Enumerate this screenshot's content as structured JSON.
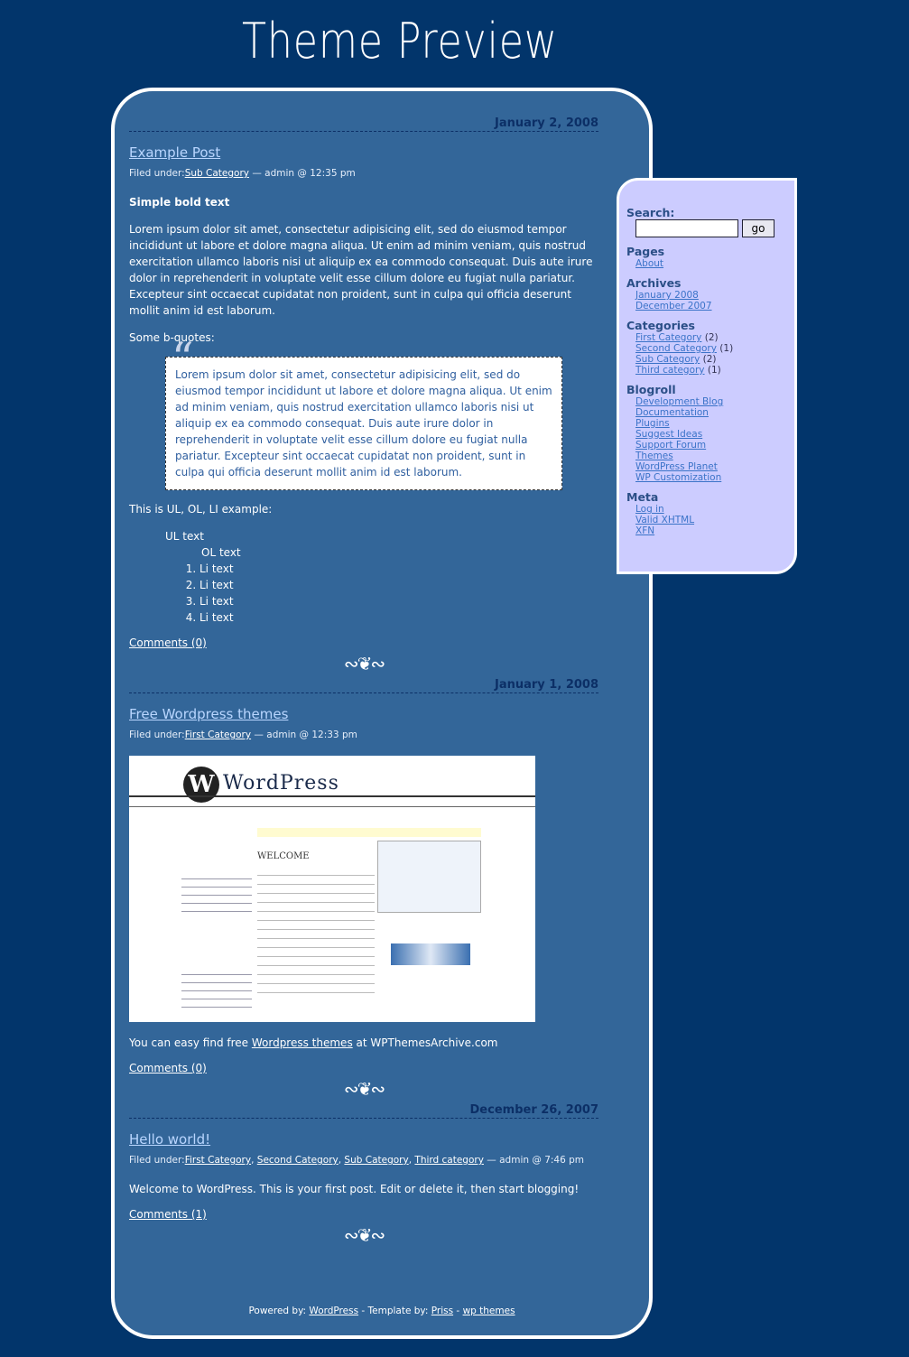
{
  "header": {
    "title": "Theme Preview"
  },
  "posts": [
    {
      "date": "January 2, 2008",
      "title": "Example Post",
      "filed_label": "Filed under:",
      "categories": [
        "Sub Category"
      ],
      "byline": " — admin @ 12:35 pm",
      "bold": "Simple bold text",
      "para": "Lorem ipsum dolor sit amet, consectetur adipisicing elit, sed do eiusmod tempor incididunt ut labore et dolore magna aliqua. Ut enim ad minim veniam, quis nostrud exercitation ullamco laboris nisi ut aliquip ex ea commodo consequat. Duis aute irure dolor in reprehenderit in voluptate velit esse cillum dolore eu fugiat nulla pariatur. Excepteur sint occaecat cupidatat non proident, sunt in culpa qui officia deserunt mollit anim id est laborum.",
      "bquote_intro": "Some b-quotes:",
      "bquote": "Lorem ipsum dolor sit amet, consectetur adipisicing elit, sed do eiusmod tempor incididunt ut labore et dolore magna aliqua. Ut enim ad minim veniam, quis nostrud exercitation ullamco laboris nisi ut aliquip ex ea commodo consequat. Duis aute irure dolor in reprehenderit in voluptate velit esse cillum dolore eu fugiat nulla pariatur. Excepteur sint occaecat cupidatat non proident, sunt in culpa qui officia deserunt mollit anim id est laborum.",
      "list_intro": "This is UL, OL, LI example:",
      "ul_text": "UL text",
      "ol_text": "OL text",
      "li": [
        "Li text",
        "Li text",
        "Li text",
        "Li text"
      ],
      "comments": "Comments (0)"
    },
    {
      "date": "January 1, 2008",
      "title": "Free Wordpress themes",
      "filed_label": "Filed under:",
      "categories": [
        "First Category"
      ],
      "byline": " — admin @ 12:33 pm",
      "text_before": "You can easy find free ",
      "link": "Wordpress themes",
      "text_after": " at WPThemesArchive.com",
      "comments": "Comments (0)",
      "screenshot": {
        "logo": "WordPress",
        "welcome": "WELCOME"
      }
    },
    {
      "date": "December 26, 2007",
      "title": "Hello world!",
      "filed_label": "Filed under:",
      "categories": [
        "First Category",
        "Second Category",
        "Sub Category",
        "Third category"
      ],
      "byline": " — admin @ 7:46 pm",
      "para": "Welcome to WordPress. This is your first post. Edit or delete it, then start blogging!",
      "comments": "Comments (1)"
    }
  ],
  "footer": {
    "powered": "Powered by: ",
    "wp": "WordPress",
    "sep1": " - Template by: ",
    "priss": "Priss",
    "sep2": " - ",
    "themes": "wp themes"
  },
  "sidebar": {
    "search_label": "Search:",
    "search_value": "",
    "go": "go",
    "pages_title": "Pages",
    "pages": [
      "About"
    ],
    "archives_title": "Archives",
    "archives": [
      "January 2008",
      "December 2007"
    ],
    "categories_title": "Categories",
    "categories": [
      {
        "name": "First Category",
        "count": "(2)"
      },
      {
        "name": "Second Category",
        "count": "(1)"
      },
      {
        "name": "Sub Category",
        "count": "(2)"
      },
      {
        "name": "Third category",
        "count": "(1)"
      }
    ],
    "blogroll_title": "Blogroll",
    "blogroll": [
      "Development Blog",
      "Documentation",
      "Plugins",
      "Suggest Ideas",
      "Support Forum",
      "Themes",
      "WordPress Planet",
      "WP Customization"
    ],
    "meta_title": "Meta",
    "meta": [
      "Log in",
      "Valid XHTML",
      "XFN"
    ]
  },
  "colors": {
    "background": "#02356b",
    "panel": "#336699",
    "sidebar": "#ccccff",
    "date": "#0c2f66",
    "post_title": "#b9d6ff"
  }
}
